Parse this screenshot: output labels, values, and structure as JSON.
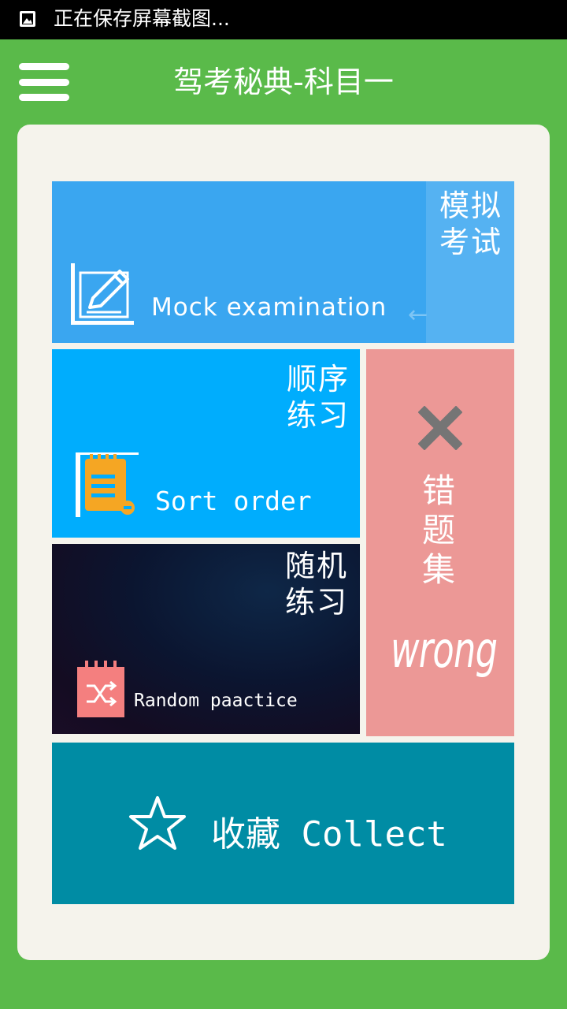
{
  "status_bar": {
    "text": "正在保存屏幕截图...",
    "icon": "image-icon"
  },
  "header": {
    "title": "驾考秘典-科目一",
    "menu_icon": "hamburger-menu-icon"
  },
  "tiles": {
    "mock": {
      "cn": "模拟\n考试",
      "en": "Mock examination",
      "icon": "edit-pencil-icon",
      "color": "#3aa6f0"
    },
    "sort": {
      "cn": "顺序\n练习",
      "en": "Sort order",
      "icon": "notepad-icon",
      "color": "#00adfd"
    },
    "random": {
      "cn": "随机\n练习",
      "en": "Random paactice",
      "icon": "shuffle-icon"
    },
    "wrong": {
      "cn": "错\n题\n集",
      "en": "wrong",
      "icon": "close-icon",
      "color": "#ec9896"
    },
    "collect": {
      "label": "收藏 Collect",
      "icon": "star-icon",
      "color": "#008ca4"
    }
  },
  "colors": {
    "app_bar": "#5aba4a",
    "card_bg": "#f5f3ec"
  }
}
